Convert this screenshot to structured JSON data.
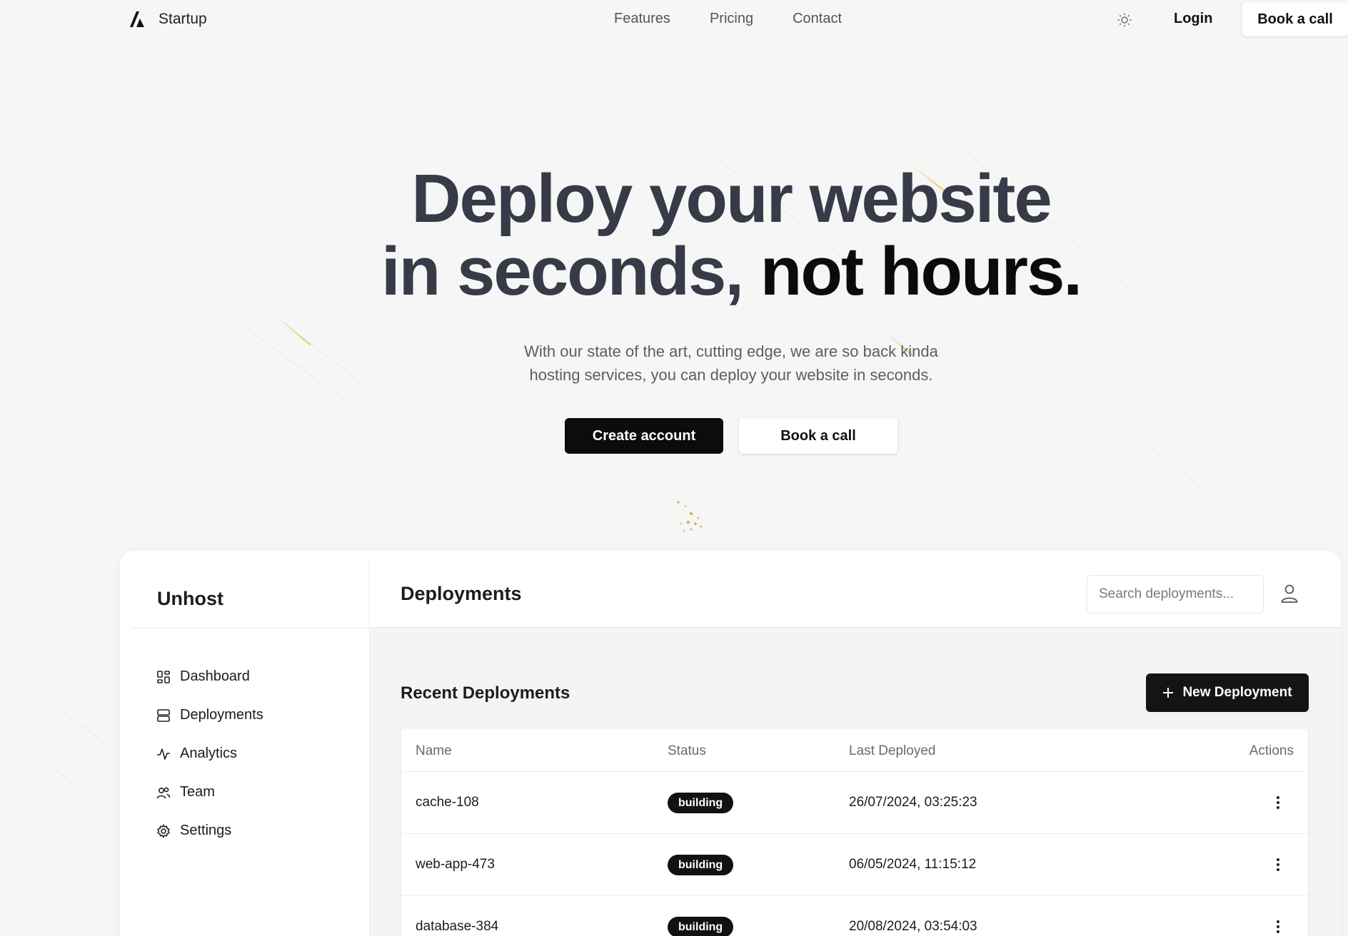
{
  "nav": {
    "brand": "Startup",
    "links": [
      "Features",
      "Pricing",
      "Contact"
    ],
    "login": "Login",
    "book_call": "Book a call"
  },
  "hero": {
    "title_line1": "Deploy your website",
    "title_line2_start": "in seconds,",
    "title_line2_emphasis": "not hours.",
    "subtitle_line1": "With our state of the art, cutting edge, we are so back kinda",
    "subtitle_line2": "hosting services, you can deploy your website in seconds.",
    "cta_primary": "Create account",
    "cta_secondary": "Book a call"
  },
  "app": {
    "brand": "Unhost",
    "sidebar": {
      "items": [
        {
          "label": "Dashboard",
          "icon": "dashboard-icon"
        },
        {
          "label": "Deployments",
          "icon": "server-icon"
        },
        {
          "label": "Analytics",
          "icon": "activity-icon"
        },
        {
          "label": "Team",
          "icon": "users-icon"
        },
        {
          "label": "Settings",
          "icon": "gear-icon"
        }
      ]
    },
    "header": {
      "title": "Deployments",
      "search_placeholder": "Search deployments..."
    },
    "section_title": "Recent Deployments",
    "new_button": "New Deployment",
    "table": {
      "columns": [
        "Name",
        "Status",
        "Last Deployed",
        "Actions"
      ],
      "rows": [
        {
          "name": "cache-108",
          "status": "building",
          "last_deployed": "26/07/2024, 03:25:23"
        },
        {
          "name": "web-app-473",
          "status": "building",
          "last_deployed": "06/05/2024, 11:15:12"
        },
        {
          "name": "database-384",
          "status": "building",
          "last_deployed": "20/08/2024, 03:54:03"
        }
      ]
    }
  },
  "colors": {
    "background": "#f6f6f6",
    "primary": "#0c0c0c",
    "hero_text": "#373b47",
    "accent_spark": "#e6be3c"
  }
}
